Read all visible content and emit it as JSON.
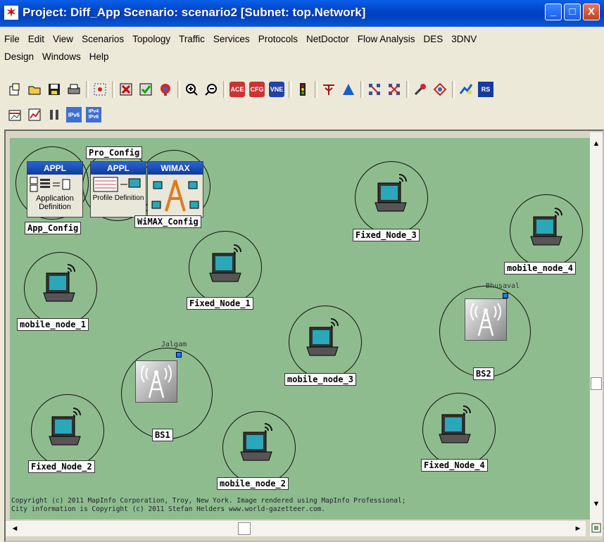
{
  "window": {
    "title": "Project: Diff_App Scenario: scenario2  [Subnet: top.Network]",
    "minimize": "_",
    "maximize": "□",
    "close": "X"
  },
  "menu": {
    "row1": [
      "File",
      "Edit",
      "View",
      "Scenarios",
      "Topology",
      "Traffic",
      "Services",
      "Protocols",
      "NetDoctor",
      "Flow Analysis",
      "DES",
      "3DNV"
    ],
    "row2": [
      "Design",
      "Windows",
      "Help"
    ]
  },
  "toolbar_icons": {
    "row1": [
      "new-project-icon",
      "open-icon",
      "save-icon",
      "print-icon",
      "object-palette-icon",
      "delete-icon",
      "verify-links-icon",
      "fail-node-icon",
      "zoom-in-icon",
      "zoom-out-icon",
      "ace-icon",
      "cfg-icon",
      "vne-icon",
      "traffic-light-icon",
      "configure-sim-icon",
      "view-results-icon",
      "hide-stats-icon",
      "clear-stats-icon",
      "web-report-icon",
      "topology-icon",
      "rsvp-icon",
      "rs-icon"
    ],
    "row2": [
      "results-browser-icon",
      "graph-icon",
      "link-icon",
      "ipv6-icon",
      "ipv4-ipv6-icon"
    ],
    "badges": {
      "ace": "ACE",
      "cfg": "CFG",
      "vne": "VNE",
      "ipv6": "IPv6",
      "ipv4v6": "IPv4\nIPv6",
      "rs": "RS"
    }
  },
  "config_objects": {
    "app": {
      "head": "APPL",
      "body": "Application Definition",
      "label": "App_Config"
    },
    "profile": {
      "head": "APPL",
      "body": "Profile Definition",
      "label": "Pro_Config"
    },
    "wimax": {
      "head": "WIMAX",
      "label": "WiMAX_Config"
    }
  },
  "nodes": {
    "fixed_node_1": "Fixed_Node_1",
    "fixed_node_2": "Fixed_Node_2",
    "fixed_node_3": "Fixed_Node_3",
    "fixed_node_4": "Fixed_Node_4",
    "mobile_node_1": "mobile_node_1",
    "mobile_node_2": "mobile_node_2",
    "mobile_node_3": "mobile_node_3",
    "mobile_node_4": "mobile_node_4"
  },
  "base_stations": {
    "bs1": {
      "label": "BS1",
      "site": "Jalgam"
    },
    "bs2": {
      "label": "BS2",
      "site": "Bhusaval"
    }
  },
  "copyright": {
    "line1": "Copyright (c) 2011 MapInfo Corporation, Troy, New York. Image rendered using MapInfo Professional;",
    "line2": "City information is Copyright (c) 2011 Stefan Helders www.world-gazetteer.com."
  },
  "scrollbars": {
    "up": "▲",
    "down": "▼",
    "left": "◄",
    "right": "►"
  },
  "colors": {
    "canvas": "#8fbc8f",
    "titlebar": "#0045c8",
    "screen": "#2aa7b8"
  }
}
